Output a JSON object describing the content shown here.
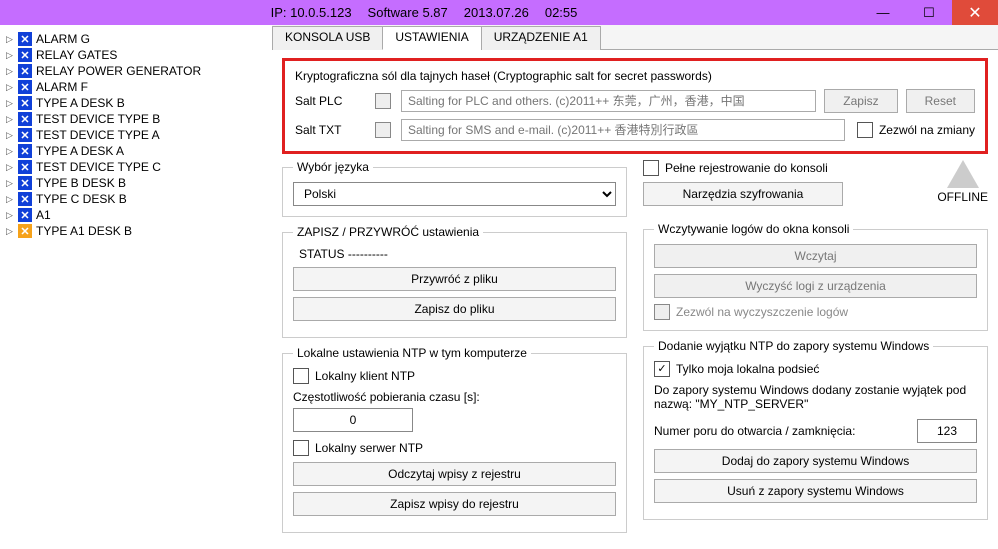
{
  "titlebar": {
    "ip": "IP: 10.0.5.123",
    "software": "Software 5.87",
    "date": "2013.07.26",
    "time": "02:55"
  },
  "tree": [
    {
      "c": "b",
      "t": "ALARM G"
    },
    {
      "c": "b",
      "t": "RELAY GATES"
    },
    {
      "c": "b",
      "t": "RELAY POWER GENERATOR"
    },
    {
      "c": "b",
      "t": "ALARM F"
    },
    {
      "c": "b",
      "t": "TYPE A DESK B"
    },
    {
      "c": "b",
      "t": "TEST DEVICE TYPE B"
    },
    {
      "c": "b",
      "t": "TEST DEVICE TYPE A"
    },
    {
      "c": "b",
      "t": "TYPE A DESK A"
    },
    {
      "c": "b",
      "t": "TEST DEVICE TYPE C"
    },
    {
      "c": "b",
      "t": "TYPE B DESK B"
    },
    {
      "c": "b",
      "t": "TYPE C DESK B"
    },
    {
      "c": "b",
      "t": "A1"
    },
    {
      "c": "o",
      "t": "TYPE A1 DESK B"
    }
  ],
  "tabs": [
    "KONSOLA USB",
    "USTAWIENIA",
    "URZĄDZENIE A1"
  ],
  "activeTab": 1,
  "crypto": {
    "title": "Kryptograficzna sól dla tajnych haseł (Cryptographic salt for secret passwords)",
    "saltPlcLabel": "Salt PLC",
    "saltPlcPlaceholder": "Salting for PLC and others. (c)2011++ 东莞，广州，香港，中国",
    "saltTxtLabel": "Salt TXT",
    "saltTxtPlaceholder": "Salting for SMS and e-mail. (c)2011++ 香港特別行政區",
    "save": "Zapisz",
    "reset": "Reset",
    "allowChanges": "Zezwól na zmiany"
  },
  "lang": {
    "title": "Wybór języka",
    "value": "Polski"
  },
  "save": {
    "title": "ZAPISZ / PRZYWRÓĆ ustawienia",
    "status": "STATUS ----------",
    "restore": "Przywróć z pliku",
    "savefile": "Zapisz do pliku"
  },
  "ntpLocal": {
    "title": "Lokalne ustawienia NTP w tym komputerze",
    "client": "Lokalny klient NTP",
    "freq": "Częstotliwość pobierania czasu [s]:",
    "freqVal": "0",
    "server": "Lokalny serwer NTP",
    "read": "Odczytaj wpisy z rejestru",
    "write": "Zapisz wpisy do rejestru"
  },
  "right": {
    "fullLog": "Pełne rejestrowanie do konsoli",
    "offline": "OFFLINE",
    "tools": "Narzędzia szyfrowania"
  },
  "logs": {
    "title": "Wczytywanie logów do okna konsoli",
    "load": "Wczytaj",
    "clear": "Wyczyść logi z urządzenia",
    "allow": "Zezwól na wyczyszczenie logów"
  },
  "fw": {
    "title": "Dodanie wyjątku NTP do zapory systemu Windows",
    "subnet": "Tylko moja lokalna podsieć",
    "text": "Do zapory systemu Windows dodany zostanie wyjątek pod nazwą: \"MY_NTP_SERVER\"",
    "portLabel": "Numer poru do otwarcia / zamknięcia:",
    "port": "123",
    "add": "Dodaj do zapory systemu Windows",
    "del": "Usuń z zapory systemu Windows"
  }
}
